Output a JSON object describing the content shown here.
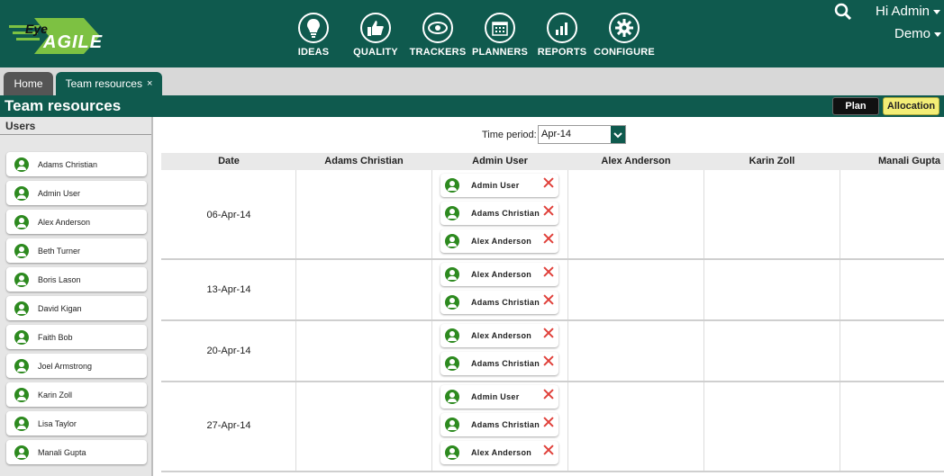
{
  "brand": {
    "logo_eye": "Eye",
    "logo_agile": "AGILE",
    "accent": "#0f5a4e",
    "highlight": "#f3ee76"
  },
  "nav": [
    {
      "label": "IDEAS",
      "icon": "lightbulb-icon"
    },
    {
      "label": "QUALITY",
      "icon": "thumbs-up-icon"
    },
    {
      "label": "TRACKERS",
      "icon": "eye-icon"
    },
    {
      "label": "PLANNERS",
      "icon": "calendar-icon"
    },
    {
      "label": "REPORTS",
      "icon": "bar-chart-icon"
    },
    {
      "label": "CONFIGURE",
      "icon": "gear-icon"
    }
  ],
  "account": {
    "greeting": "Hi Admin",
    "workspace": "Demo"
  },
  "tabs": {
    "home": "Home",
    "team": "Team resources",
    "close": "×"
  },
  "page": {
    "title": "Team resources",
    "plan_label": "Plan",
    "allocation_label": "Allocation"
  },
  "sidebar": {
    "heading": "Users",
    "users": [
      "Adams Christian",
      "Admin User",
      "Alex Anderson",
      "Beth Turner",
      "Boris Lason",
      "David Kigan",
      "Faith Bob",
      "Joel Armstrong",
      "Karin Zoll",
      "Lisa Taylor",
      "Manali Gupta"
    ]
  },
  "filter": {
    "label": "Time period:",
    "value": "Apr-14"
  },
  "grid": {
    "columns": [
      "Date",
      "Adams Christian",
      "Admin User",
      "Alex Anderson",
      "Karin Zoll",
      "Manali Gupta"
    ],
    "rows": [
      {
        "date": "06-Apr-14",
        "admin_user": [
          "Admin User",
          "Adams Christian",
          "Alex Anderson"
        ]
      },
      {
        "date": "13-Apr-14",
        "admin_user": [
          "Alex Anderson",
          "Adams Christian"
        ]
      },
      {
        "date": "20-Apr-14",
        "admin_user": [
          "Alex Anderson",
          "Adams Christian"
        ]
      },
      {
        "date": "27-Apr-14",
        "admin_user": [
          "Admin User",
          "Adams Christian",
          "Alex Anderson"
        ]
      }
    ]
  }
}
